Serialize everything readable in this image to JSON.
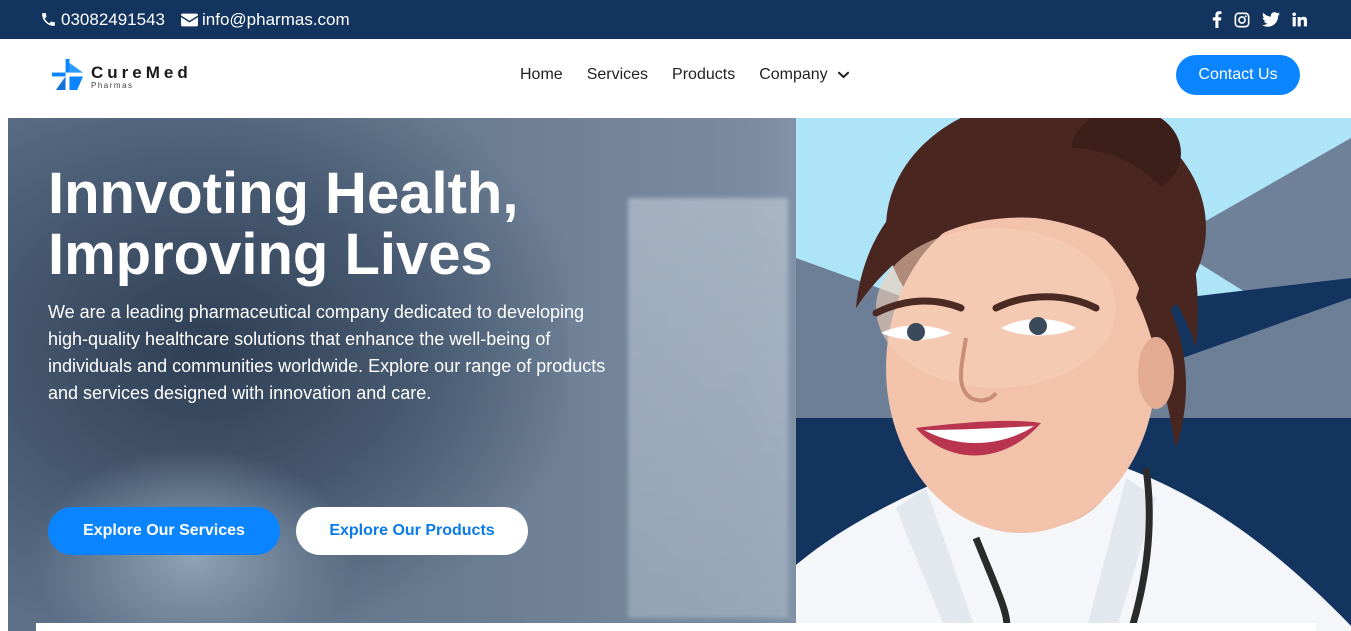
{
  "topbar": {
    "phone": "03082491543",
    "email": "info@pharmas.com",
    "social_icons": [
      "facebook-icon",
      "instagram-icon",
      "twitter-icon",
      "linkedin-icon"
    ]
  },
  "logo": {
    "name": "CureMed",
    "subtitle": "Pharmas"
  },
  "nav": {
    "items": [
      "Home",
      "Services",
      "Products",
      "Company"
    ],
    "contact_label": "Contact Us"
  },
  "hero": {
    "title_line1": "Innvoting Health,",
    "title_line2": "Improving Lives",
    "description": "We are a leading pharmaceutical company dedicated to developing high-quality healthcare solutions that enhance the well-being of individuals and communities worldwide. Explore our range of products and services designed with innovation and care.",
    "primary_button": "Explore Our Services",
    "secondary_button": "Explore Our Products"
  },
  "colors": {
    "topbar": "#12345f",
    "accent": "#0a84ff",
    "light_blue": "#aee4f7",
    "navy": "#12345f"
  }
}
